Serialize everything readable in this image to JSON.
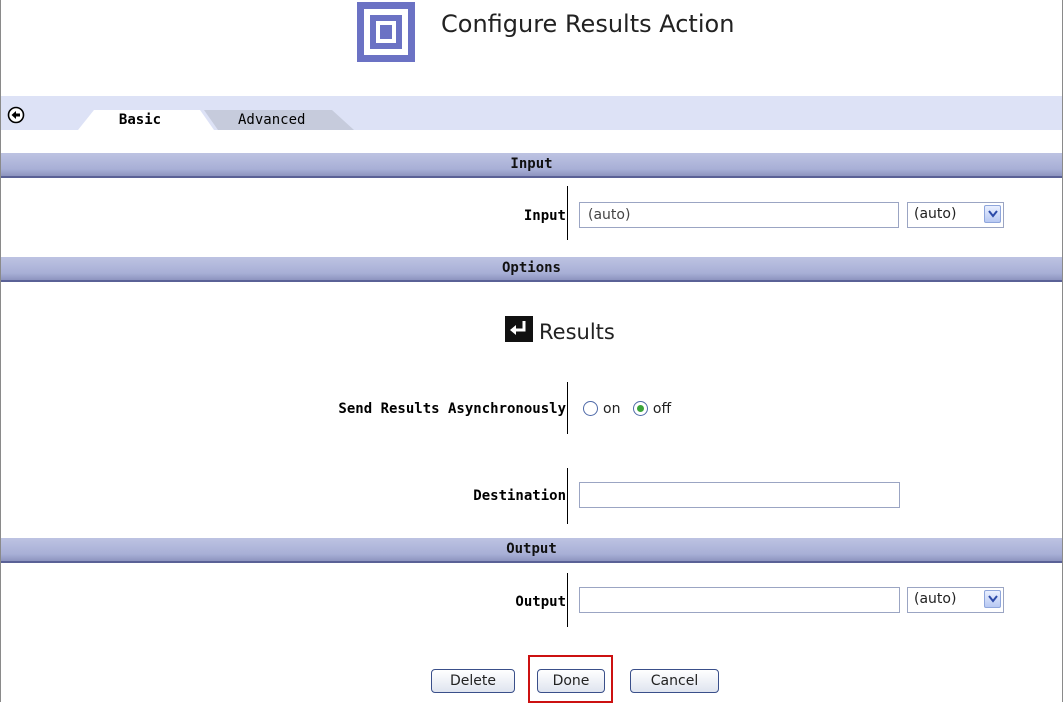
{
  "header": {
    "title": "Configure Results Action",
    "icon": "nested-square-icon"
  },
  "tabs": [
    {
      "label": "Basic",
      "active": true
    },
    {
      "label": "Advanced",
      "active": false
    }
  ],
  "back_icon": "back-arrow-circle-icon",
  "sections": {
    "input": "Input",
    "options": "Options",
    "output": "Output"
  },
  "input_row": {
    "label": "Input",
    "value": "(auto)",
    "select_value": "(auto)"
  },
  "results": {
    "heading": "Results",
    "icon": "return-arrow-icon"
  },
  "async_row": {
    "label": "Send Results Asynchronously",
    "options": [
      {
        "label": "on",
        "checked": false
      },
      {
        "label": "off",
        "checked": true
      }
    ]
  },
  "destination_row": {
    "label": "Destination",
    "value": ""
  },
  "output_row": {
    "label": "Output",
    "value": "",
    "select_value": "(auto)"
  },
  "buttons": {
    "delete": "Delete",
    "done": "Done",
    "cancel": "Cancel"
  },
  "colors": {
    "section_bar": "#a8afd6",
    "tab_bar": "#dde2f6",
    "highlight": "#cc1111"
  }
}
